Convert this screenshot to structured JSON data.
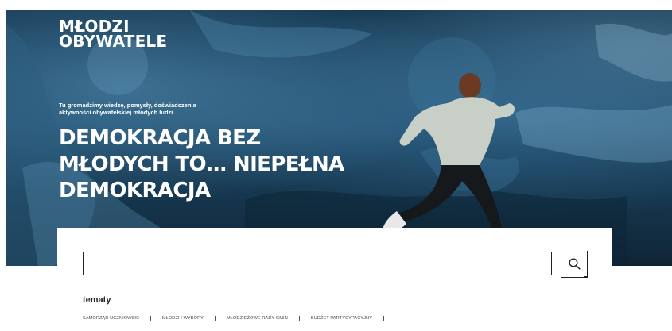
{
  "brand": {
    "line1": "MŁODZI",
    "line2": "OBYWATELE"
  },
  "hero": {
    "tagline": "Tu gromadzimy wiedzę, pomysły, doświadczenia aktywności obywatelskiej młodych ludzi.",
    "headline_lines": [
      "DEMOKRACJA BEZ",
      "MŁODYCH TO… NIEPEŁNA",
      "DEMOKRACJA"
    ]
  },
  "search": {
    "value": "",
    "placeholder": ""
  },
  "topics": {
    "title": "tematy",
    "items": [
      "SAMORZĄD UCZNIOWSKI",
      "MŁODZI I WYBORY",
      "MŁODZIEŻOWE RADY GMIN",
      "BUDŻET PARTYCYPACYJNY"
    ]
  },
  "colors": {
    "hero_dark": "#14364f",
    "hero_mid": "#1c4866",
    "text_light": "#ffffff",
    "text_dark": "#222222"
  },
  "icons": {
    "search": "search-icon"
  }
}
